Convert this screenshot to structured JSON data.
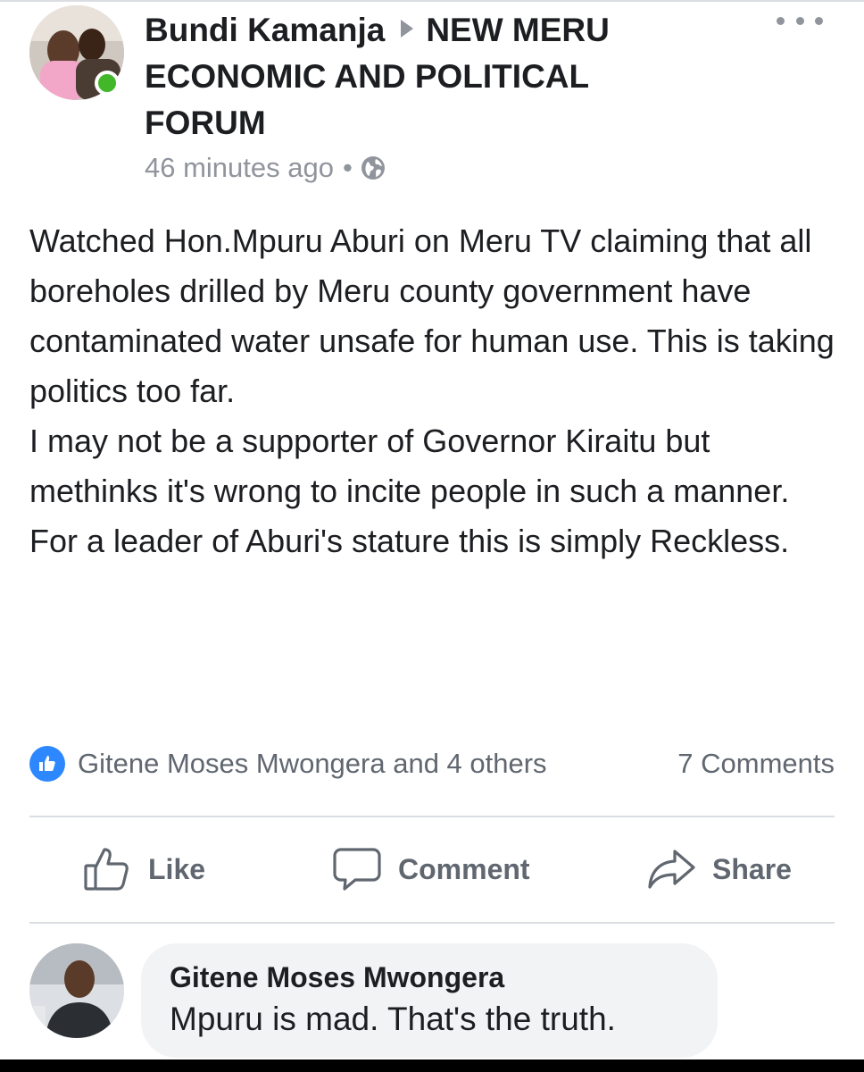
{
  "post": {
    "author": "Bundi Kamanja",
    "group": "NEW MERU ECONOMIC AND POLITICAL FORUM",
    "time": "46 minutes ago",
    "body": "Watched Hon.Mpuru Aburi on Meru TV claiming that all boreholes drilled by Meru county government have contaminated water unsafe for human use. This is taking politics too far.\nI may not be a supporter of Governor Kiraitu but methinks it's wrong to incite people in such a manner.\nFor a leader of Aburi's stature this is simply Reckless."
  },
  "reactions": {
    "names": "Gitene Moses Mwongera and 4 others",
    "comments": "7 Comments"
  },
  "actions": {
    "like": "Like",
    "comment": "Comment",
    "share": "Share"
  },
  "comment": {
    "author": "Gitene Moses Mwongera",
    "text": "Mpuru is mad. That's the truth."
  },
  "colors": {
    "accent": "#2d88ff",
    "online": "#42b72a",
    "muted": "#606770"
  }
}
